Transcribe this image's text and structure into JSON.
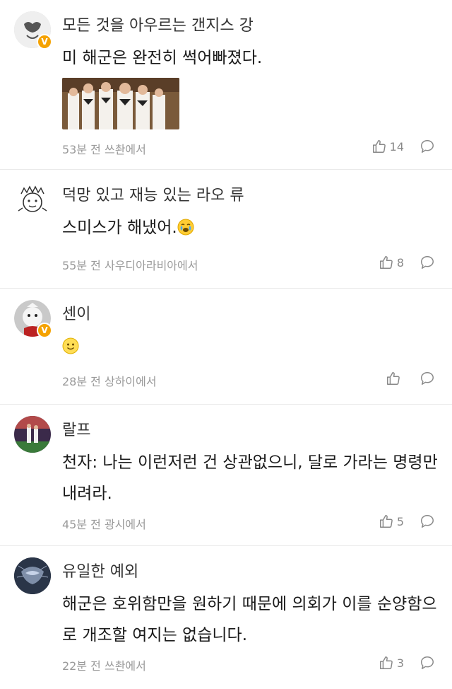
{
  "comments": [
    {
      "username": "모든 것을 아우르는 갠지스 강",
      "text": "미 해군은 완전히 썩어빠졌다.",
      "meta": "53분 전 쓰촨에서",
      "likes": "14",
      "verified": true,
      "has_image": true
    },
    {
      "username": "덕망 있고 재능 있는 라오 류",
      "text": "스미스가 해냈어.",
      "meta": "55분 전 사우디아라비아에서",
      "likes": "8",
      "verified": false
    },
    {
      "username": "센이",
      "text": "",
      "meta": "28분 전 상하이에서",
      "likes": "",
      "verified": true
    },
    {
      "username": "랄프",
      "text": "천자: 나는 이런저런 건 상관없으니, 달로 가라는 명령만 내려라.",
      "meta": "45분 전 광시에서",
      "likes": "5",
      "verified": false
    },
    {
      "username": "유일한 예외",
      "text": "해군은 호위함만을 원하기 때문에 의회가 이를 순양함으로 개조할 여지는 없습니다.",
      "meta": "22분 전 쓰촨에서",
      "likes": "3",
      "verified": false
    }
  ],
  "icons": {
    "like": "thumbs-up-icon",
    "reply": "speech-bubble-icon",
    "verified": "v-badge-icon",
    "emoji_cry": "crying-face-emoji",
    "emoji_smile": "smiling-face-emoji"
  },
  "colors": {
    "verified_badge": "#f5a200",
    "meta_text": "#9a9a9a",
    "divider": "#e9e9e9"
  }
}
